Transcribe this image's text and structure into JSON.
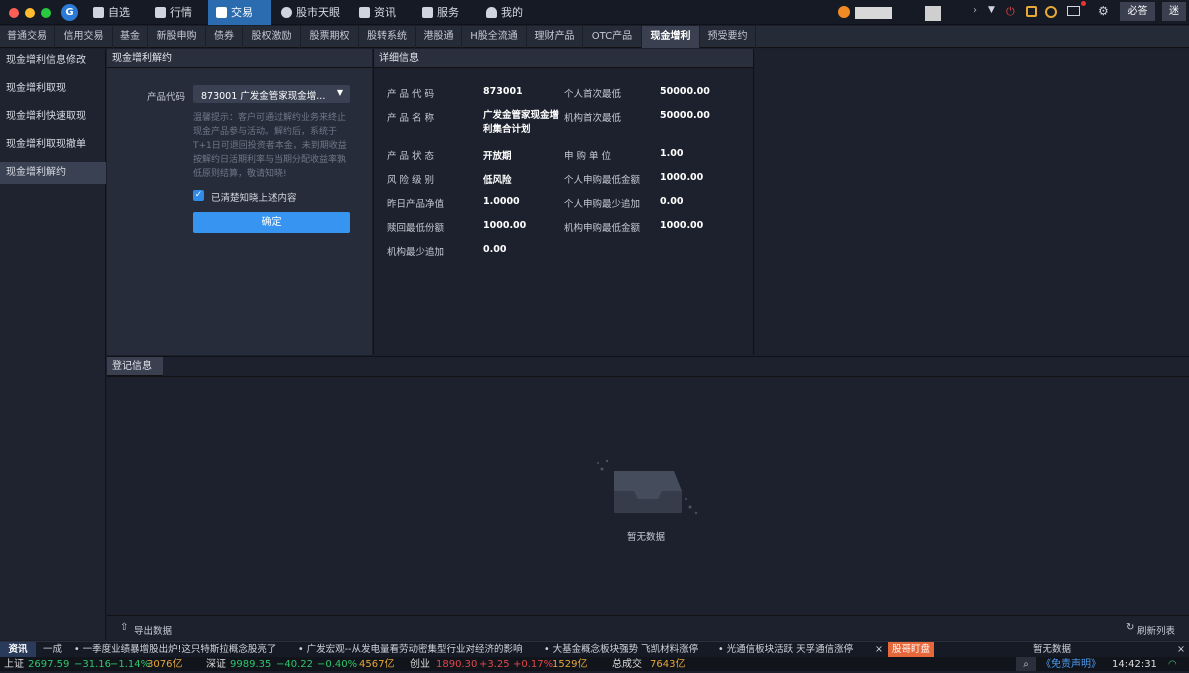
{
  "nav": {
    "items": [
      {
        "label": "自选",
        "icon": "star-box-icon"
      },
      {
        "label": "行情",
        "icon": "chart-line-icon"
      },
      {
        "label": "交易",
        "icon": "gavel-icon"
      },
      {
        "label": "股市天眼",
        "icon": "eye-icon"
      },
      {
        "label": "资讯",
        "icon": "newspaper-icon"
      },
      {
        "label": "服务",
        "icon": "briefcase-icon"
      },
      {
        "label": "我的",
        "icon": "person-icon"
      }
    ],
    "btn_bida": "必答",
    "btn_mi": "迷"
  },
  "tabs": [
    "普通交易",
    "信用交易",
    "基金",
    "新股申购",
    "债券",
    "股权激励",
    "股票期权",
    "股转系统",
    "港股通",
    "H股全流通",
    "理财产品",
    "OTC产品",
    "现金增利",
    "预受要约"
  ],
  "sidebar": [
    "现金增利信息修改",
    "现金增利取现",
    "现金增利快速取现",
    "现金增利取现撤单",
    "现金增利解约"
  ],
  "form": {
    "title": "现金增利解约",
    "code_label": "产品代码",
    "code_value": "873001 广发金管家现金增...",
    "tip": "温馨提示：客户可通过解约业务来终止现金产品参与活动。解约后，系统于T+1日可退回投资者本金，未到期收益按解约日活期利率与当期分配收益率孰低原则结算，敬请知晓!",
    "checkbox_label": "已清楚知晓上述内容",
    "confirm": "确定"
  },
  "detail": {
    "title": "详细信息",
    "rows": [
      {
        "l1": "产 品 代 码",
        "v1": "873001",
        "l2": "个人首次最低",
        "v2": "50000.00"
      },
      {
        "l1": "产 品 名 称",
        "v1": "广发金管家现金增利集合计划",
        "l2": "机构首次最低",
        "v2": "50000.00"
      },
      {
        "l1": "产 品 状 态",
        "v1": "开放期",
        "l2": "申 购 单 位",
        "v2": "1.00"
      },
      {
        "l1": "风 险 级 别",
        "v1": "低风险",
        "l2": "个人申购最低金额",
        "v2": "1000.00"
      },
      {
        "l1": "昨日产品净值",
        "v1": "1.0000",
        "l2": "个人申购最少追加",
        "v2": "0.00"
      },
      {
        "l1": "赎回最低份额",
        "v1": "1000.00",
        "l2": "机构申购最低金额",
        "v2": "1000.00"
      },
      {
        "l1": "机构最少追加",
        "v1": "0.00",
        "l2": "",
        "v2": ""
      }
    ]
  },
  "register": {
    "title": "登记信息",
    "empty": "暂无数据",
    "export": "导出数据",
    "refresh": "刷新列表"
  },
  "ticker": {
    "tag": "资讯",
    "tag2": "一成",
    "items": [
      "一季度业绩暴增股出炉!这只特斯拉概念股亮了",
      "广发宏观--从发电量看劳动密集型行业对经济的影响",
      "大基金概念板块强势 飞凯材料涨停",
      "光通信板块活跃 天孚通信涨停"
    ],
    "close": "×",
    "badge": "股哥盯盘",
    "right_text": "暂无数据",
    "close2": "×"
  },
  "status": {
    "sh_label": "上证",
    "sh_value": "2697.59",
    "sh_change": "−31.16",
    "sh_pct": "−1.14%",
    "sh_vol": "3076亿",
    "sz_label": "深证",
    "sz_value": "9989.35",
    "sz_change": "−40.22",
    "sz_pct": "−0.40%",
    "sz_vol": "4567亿",
    "cy_label": "创业",
    "cy_value": "1890.30",
    "cy_change": "+3.25",
    "cy_pct": "+0.17%",
    "cy_vol": "1529亿",
    "total_label": "总成交",
    "total_vol": "7643亿",
    "disclaimer": "《免责声明》",
    "time": "14:42:31"
  }
}
